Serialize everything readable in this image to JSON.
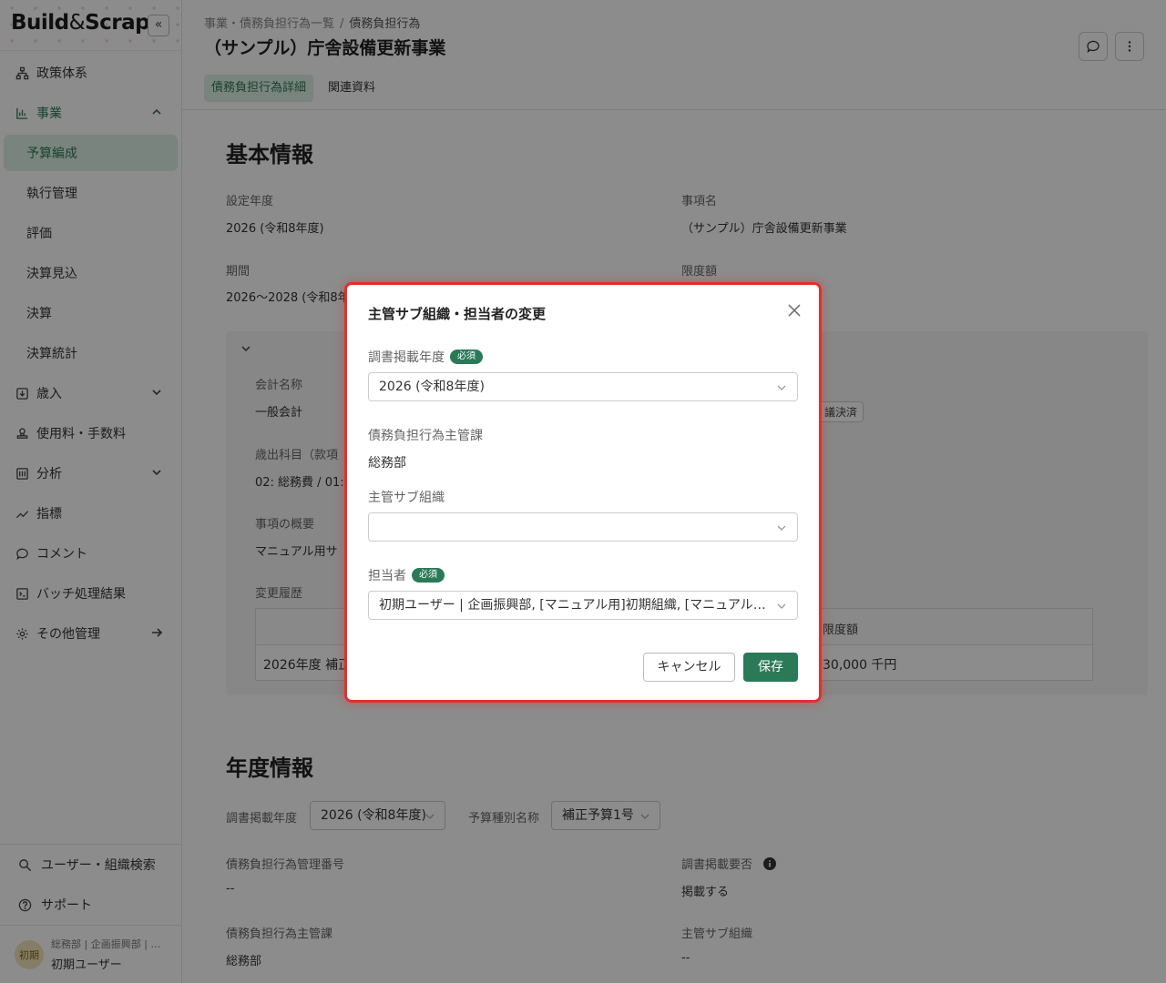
{
  "brand": {
    "name_left": "Build",
    "amp": "&",
    "name_right": "Scrap",
    "collapse_glyph": "«"
  },
  "sidebar": {
    "items": [
      {
        "label": "政策体系",
        "icon": "hierarchy-icon"
      },
      {
        "label": "事業",
        "icon": "bar-chart-icon",
        "expanded": true
      },
      {
        "label": "歳入",
        "icon": "import-icon"
      },
      {
        "label": "使用料・手数料",
        "icon": "stamp-icon"
      },
      {
        "label": "分析",
        "icon": "analysis-icon"
      },
      {
        "label": "指標",
        "icon": "trend-icon"
      },
      {
        "label": "コメント",
        "icon": "comment-icon"
      },
      {
        "label": "バッチ処理結果",
        "icon": "terminal-icon"
      },
      {
        "label": "その他管理",
        "icon": "gear-icon"
      }
    ],
    "sub_items": [
      "予算編成",
      "執行管理",
      "評価",
      "決算見込",
      "決算",
      "決算統計"
    ],
    "bottom": {
      "search": "ユーザー・組織検索",
      "support": "サポート"
    },
    "user": {
      "avatar": "初期",
      "org": "総務部 | 企画振興部 | …",
      "name": "初期ユーザー"
    }
  },
  "header": {
    "breadcrumb": [
      "事業・債務負担行為一覧",
      "債務負担行為"
    ],
    "breadcrumb_sep": "/",
    "title": "（サンプル）庁舎設備更新事業",
    "tabs": [
      "債務負担行為詳細",
      "関連資料"
    ]
  },
  "basic": {
    "title": "基本情報",
    "year_label": "設定年度",
    "year_value": "2026 (令和8年度)",
    "item_label": "事項名",
    "item_value": "（サンプル）庁舎設備更新事業",
    "period_label": "期間",
    "period_value": "2026〜2028 (令和8年",
    "limit_label": "限度額",
    "account_label": "会計名称",
    "account_value": "一般会計",
    "expense_label": "歳出科目（款項",
    "expense_value": "02: 総務費 / 01:",
    "decided_chip": "議決済",
    "summary_label": "事項の概要",
    "summary_value": "マニュアル用サ",
    "history_label": "変更履歴",
    "history_limit_header": "限度額",
    "history_row_name": "2026年度 補正",
    "history_row_amount": "30,000 千円"
  },
  "yearly": {
    "title": "年度情報",
    "pub_year_label": "調書掲載年度",
    "pub_year_value": "2026 (令和8年度)",
    "budget_type_label": "予算種別名称",
    "budget_type_value": "補正予算1号",
    "mgmt_no_label": "債務負担行為管理番号",
    "mgmt_no_value": "--",
    "publish_label": "調書掲載要否",
    "publish_value": "掲載する",
    "dept_label": "債務負担行為主管課",
    "dept_value": "総務部",
    "suborg_label": "主管サブ組織",
    "suborg_value": "--"
  },
  "modal": {
    "title": "主管サブ組織・担当者の変更",
    "pub_year_label": "調書掲載年度",
    "required_badge": "必須",
    "pub_year_value": "2026 (令和8年度)",
    "dept_label": "債務負担行為主管課",
    "dept_value": "総務部",
    "suborg_label": "主管サブ組織",
    "suborg_value": "",
    "assignee_label": "担当者",
    "assignee_value": "初期ユーザー | 企画振興部, [マニュアル用]初期組織, [マニュアル用…",
    "cancel_label": "キャンセル",
    "save_label": "保存"
  },
  "colors": {
    "accent": "#2a7a57",
    "accent_bg": "#dff0e6",
    "highlight": "#e03030"
  }
}
